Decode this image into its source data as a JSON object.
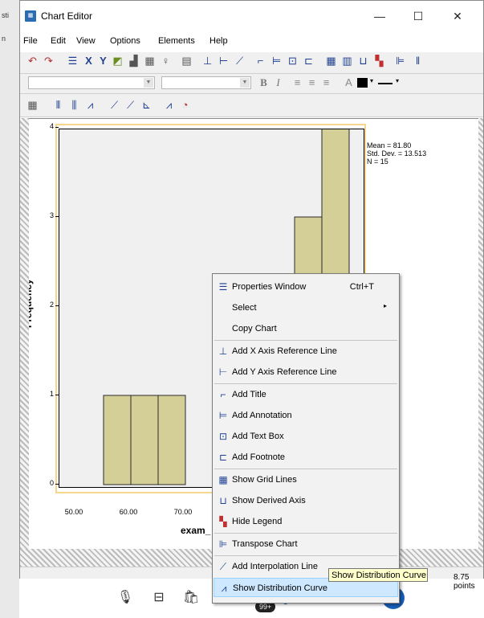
{
  "bg_window_fragments": [
    "sti",
    "n"
  ],
  "window": {
    "title": "Chart Editor",
    "app_icon": "chart-editor-app-icon",
    "minimize": "—",
    "maximize": "☐",
    "close": "✕"
  },
  "menubar": [
    {
      "label": "File"
    },
    {
      "label": "Edit"
    },
    {
      "label": "View"
    },
    {
      "label": "Options"
    },
    {
      "label": "Elements"
    },
    {
      "label": "Help"
    }
  ],
  "toolbar": {
    "font_size_combo": "",
    "font_name_combo": "",
    "bold": "B",
    "italic": "I"
  },
  "chart_data": {
    "type": "bar",
    "categories": [
      "52.5",
      "57.5",
      "62.5",
      "67.5",
      "72.5",
      "77.5",
      "82.5",
      "87.5",
      "92.5",
      "97.5"
    ],
    "values": [
      0,
      1,
      1,
      1,
      0,
      2,
      1,
      2,
      3,
      4
    ],
    "ylabel": "Frequency",
    "xlabel": "exam_",
    "yticks": [
      "0",
      "1",
      "2",
      "3",
      "4"
    ],
    "xticks": [
      "50.00",
      "60.00",
      "70.00"
    ],
    "ylim": [
      0,
      4.2
    ],
    "stats": [
      "Mean = 81.80",
      "Std. Dev. = 13.513",
      "N = 15"
    ],
    "colors": {
      "bar": "#d4cf96",
      "plot_background": "#f0f0f0",
      "frame": "#f5d68b"
    }
  },
  "context_menu": {
    "items": [
      {
        "label": "Properties Window",
        "shortcut": "Ctrl+T",
        "icon": "properties-icon"
      },
      {
        "label": "Select",
        "submenu": "▸"
      },
      {
        "label": "Copy Chart"
      },
      {
        "label": "Add X Axis Reference Line",
        "icon": "x-ref-line-icon"
      },
      {
        "label": "Add Y Axis Reference Line",
        "icon": "y-ref-line-icon"
      },
      {
        "label": "Add Title",
        "icon": "title-icon"
      },
      {
        "label": "Add Annotation",
        "icon": "annotation-icon"
      },
      {
        "label": "Add Text Box",
        "icon": "text-box-icon"
      },
      {
        "label": "Add Footnote",
        "icon": "footnote-icon"
      },
      {
        "label": "Show Grid Lines",
        "icon": "grid-lines-icon"
      },
      {
        "label": "Show Derived Axis",
        "icon": "derived-axis-icon"
      },
      {
        "label": "Hide Legend",
        "icon": "legend-icon"
      },
      {
        "label": "Transpose Chart",
        "icon": "transpose-icon"
      },
      {
        "label": "Add Interpolation Line",
        "icon": "interpolation-line-icon"
      },
      {
        "label": "Show Distribution Curve",
        "icon": "distribution-curve-icon"
      }
    ]
  },
  "tooltip": "Show Distribution Curve",
  "status": {
    "points": "8.75 points"
  },
  "taskbar": {
    "badge": "99+"
  }
}
